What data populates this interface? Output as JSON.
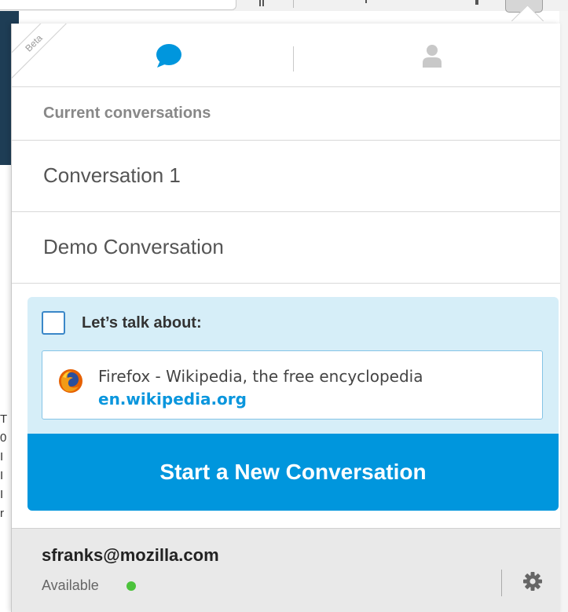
{
  "panel": {
    "beta_badge": "Beta",
    "tabs": [
      {
        "name": "rooms",
        "icon": "chat-bubble-icon",
        "active_color": "#0096dd"
      },
      {
        "name": "contacts",
        "icon": "contact-person-icon",
        "color": "#c8c8c8"
      }
    ]
  },
  "conversations": {
    "header": "Current conversations",
    "items": [
      {
        "label": "Conversation 1"
      },
      {
        "label": "Demo Conversation"
      }
    ]
  },
  "context": {
    "checkbox_label": "Let’s talk about:",
    "page_title": "Firefox - Wikipedia, the free encyclopedia",
    "page_url": "en.wikipedia.org",
    "favicon": "firefox-logo-icon"
  },
  "actions": {
    "start_button": "Start a New Conversation",
    "button_color": "#0096dd"
  },
  "account": {
    "email": "sfranks@mozilla.com",
    "status": "Available",
    "status_color": "#4cc33c",
    "settings_icon": "gear-icon"
  }
}
